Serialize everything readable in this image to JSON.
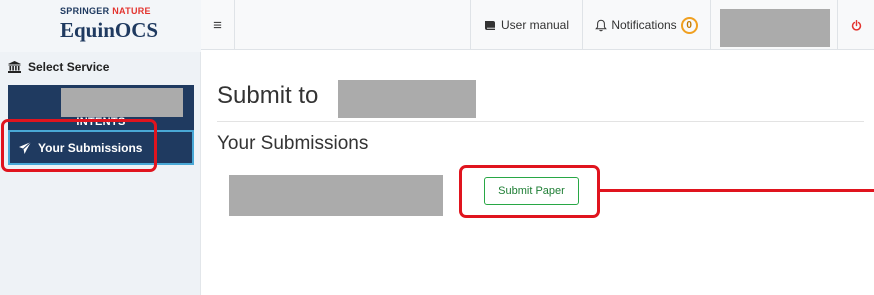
{
  "brand": {
    "publisher_part1": "SPRINGER",
    "publisher_part2": "NATURE",
    "product": "EquinOCS",
    "publisher_accent_color": "#e3342f"
  },
  "sidebar": {
    "select_service_label": "Select Service",
    "select_service_icon": "institution-icon",
    "conference_acronym": "INTENTS",
    "items": [
      {
        "label": "Your Submissions",
        "icon": "paper-plane-icon",
        "active": true
      }
    ]
  },
  "topbar": {
    "menu_icon": "hamburger-icon",
    "user_manual_label": "User manual",
    "user_manual_icon": "book-icon",
    "notifications_label": "Notifications",
    "notifications_icon": "bell-icon",
    "notifications_count": "0",
    "power_icon": "power-icon"
  },
  "main": {
    "title": "Submit to",
    "section_title": "Your Submissions",
    "submit_button_label": "Submit Paper"
  },
  "colors": {
    "navy": "#1f3a60",
    "active_border": "#49a8d6",
    "submit_green": "#28a745",
    "badge_orange": "#f0a020",
    "power_red": "#e3342f",
    "callout_red": "#e0141e",
    "redaction_gray": "#ababab"
  }
}
